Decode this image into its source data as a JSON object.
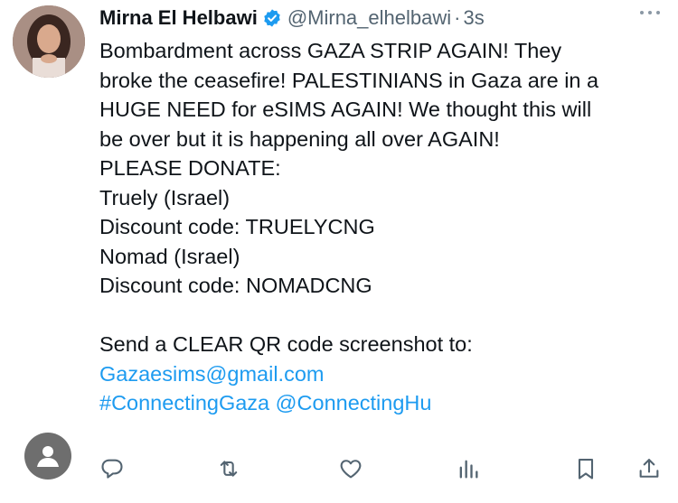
{
  "author": {
    "name": "Mirna El Helbawi",
    "handle": "@Mirna_elhelbawi",
    "separator": "·",
    "time": "3s",
    "verified": true
  },
  "tweet": {
    "lines": [
      "Bombardment across GAZA STRIP AGAIN! They",
      "broke the ceasefire! PALESTINIANS in Gaza are in a",
      "HUGE NEED for eSIMS AGAIN! We thought this will",
      "be over but it is happening all over AGAIN!",
      "PLEASE DONATE:",
      "Truely (Israel)",
      "Discount code: TRUELYCNG",
      "Nomad (Israel)",
      "Discount code: NOMADCNG",
      "Send a CLEAR QR code screenshot to:"
    ],
    "email": "Gazaesims@gmail.com",
    "hashtag": "#ConnectingGaza",
    "mention": "@ConnectingHu"
  },
  "icons": {
    "more": "more-icon",
    "reply": "reply-icon",
    "retweet": "retweet-icon",
    "like": "like-icon",
    "views": "views-icon",
    "bookmark": "bookmark-icon",
    "share": "share-icon"
  },
  "colors": {
    "text": "#0f1419",
    "secondary": "#536471",
    "link": "#1d9bf0",
    "verified": "#1d9bf0"
  }
}
